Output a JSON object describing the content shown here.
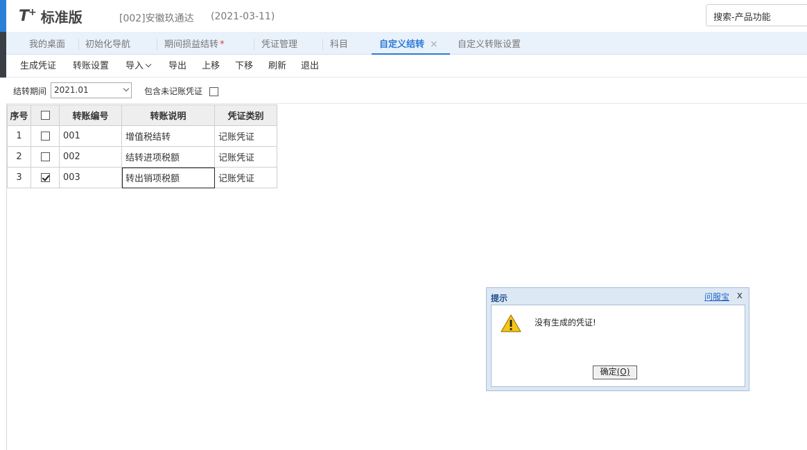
{
  "header": {
    "logo_mark": "T",
    "logo_plus": "+",
    "product": "标准版",
    "company": "[002]安徽玖通达",
    "date": "(2021-03-11)",
    "search_placeholder": "搜索-产品功能"
  },
  "tabs": [
    {
      "label": "我的桌面"
    },
    {
      "label": "初始化导航"
    },
    {
      "label": "期间损益结转",
      "modified": "*"
    },
    {
      "label": "凭证管理"
    },
    {
      "label": "科目"
    },
    {
      "label": "自定义结转",
      "close": "×"
    },
    {
      "label": "自定义转账设置"
    }
  ],
  "toolbar": {
    "generate": "生成凭证",
    "settings": "转账设置",
    "import": "导入",
    "export": "导出",
    "move_up": "上移",
    "move_down": "下移",
    "refresh": "刷新",
    "exit": "退出"
  },
  "filter": {
    "period_label": "结转期间",
    "period_value": "2021.01",
    "include_label": "包含未记账凭证",
    "include_checked": false
  },
  "grid": {
    "headers": {
      "seq": "序号",
      "code": "转账编号",
      "desc": "转账说明",
      "type": "凭证类别"
    },
    "rows": [
      {
        "seq": "1",
        "checked": false,
        "code": "001",
        "desc": "增值税结转",
        "type": "记账凭证"
      },
      {
        "seq": "2",
        "checked": false,
        "code": "002",
        "desc": "结转进项税额",
        "type": "记账凭证"
      },
      {
        "seq": "3",
        "checked": true,
        "code": "003",
        "desc": "转出销项税额",
        "type": "记账凭证"
      }
    ]
  },
  "dialog": {
    "title": "提示",
    "help": "问服宝",
    "close": "x",
    "icon": "warning-icon",
    "message": "没有生成的凭证!",
    "ok_label": "确定",
    "ok_key": "(O)"
  },
  "colors": {
    "accent": "#2b7bd6",
    "tab_bar_bg": "#e9f1fb",
    "dialog_bg": "#dde8f5"
  }
}
